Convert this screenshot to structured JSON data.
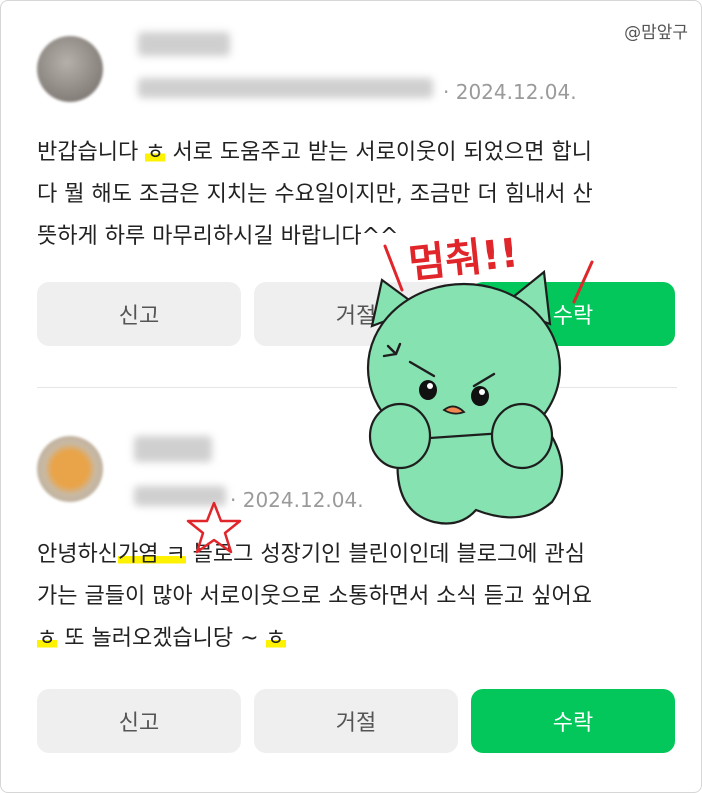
{
  "watermark": "@맘앞구",
  "requests": [
    {
      "date": "· 2024.12.04.",
      "message_lines": [
        {
          "pre": "반갑습니다 ",
          "hl": "ㅎ",
          "post": " 서로 도움주고 받는 서로이웃이 되었으면 합니"
        },
        {
          "pre": "다 뭘 해도 조금은 지치는 수요일이지만, 조금만 더 힘내서 산",
          "hl": "",
          "post": ""
        },
        {
          "pre": "뜻하게 하루 마무리하시길 바랍니다^^",
          "hl": "",
          "post": ""
        }
      ],
      "buttons": {
        "report": "신고",
        "reject": "거절",
        "accept": "수락"
      }
    },
    {
      "date": "· 2024.12.04.",
      "message_lines": [
        {
          "pre": "안녕하신",
          "hl": "가염 ㅋ",
          "post": " 블로그 성장기인 블린이인데 블로그에 관심"
        },
        {
          "pre": "가는 글들이 많아 서로이웃으로 소통하면서 소식 듣고 싶어요",
          "hl": "",
          "post": ""
        },
        {
          "pre": "",
          "hl": "ㅎ",
          "post": " 또 놀러오겠습니당 ~ ",
          "hl2": "ㅎ"
        }
      ],
      "buttons": {
        "report": "신고",
        "reject": "거절",
        "accept": "수락"
      }
    }
  ],
  "sticker": {
    "text": "멈춰!!",
    "icon": "green-cat-sticker"
  },
  "colors": {
    "accent": "#03c75a",
    "highlight": "#fff200",
    "sticker_text": "#e0262a",
    "sticker_body": "#86e2b0"
  }
}
